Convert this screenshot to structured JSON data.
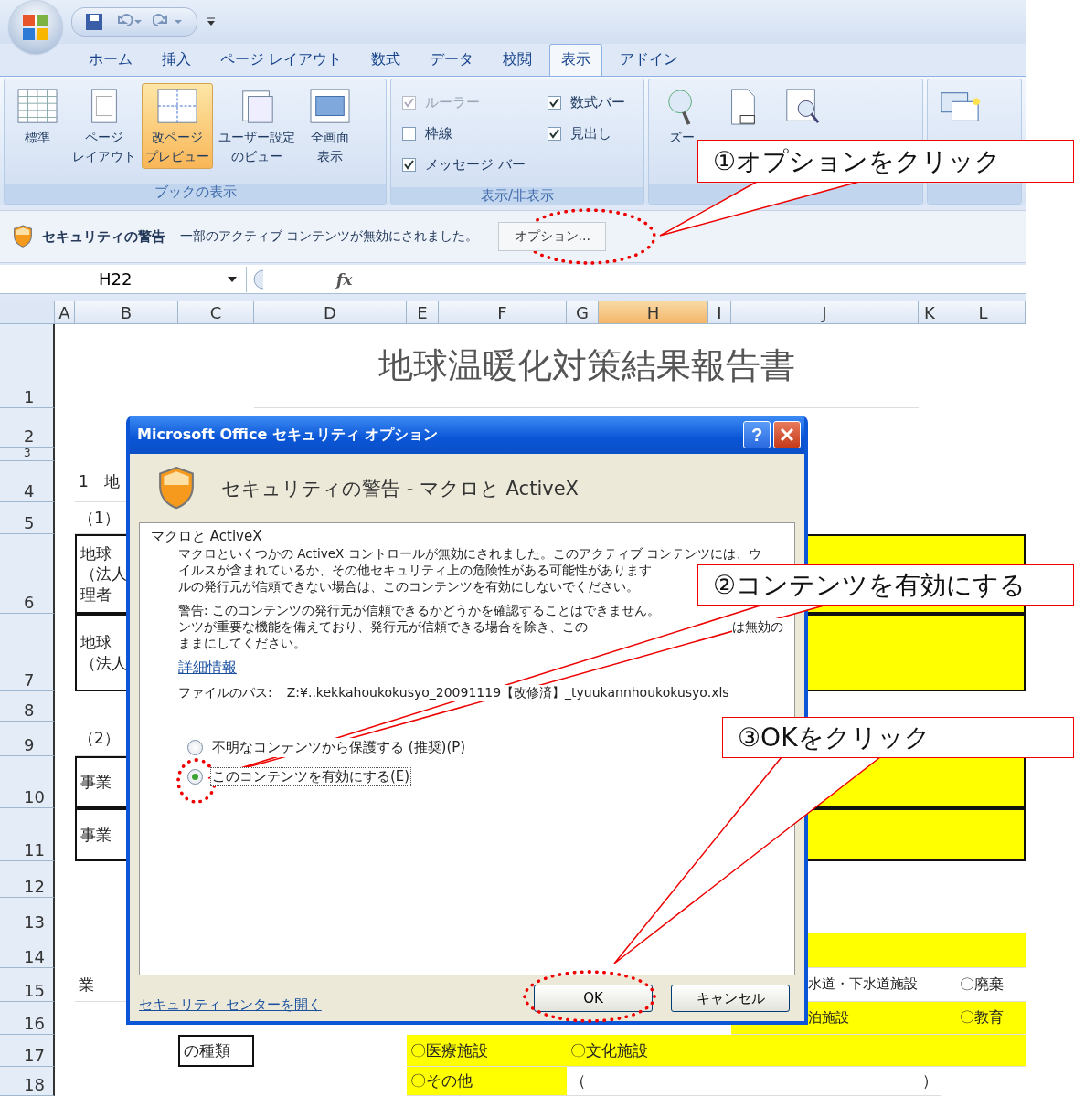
{
  "tabs": [
    {
      "label": "ホーム",
      "selected": false
    },
    {
      "label": "挿入",
      "selected": false
    },
    {
      "label": "ページ レイアウト",
      "selected": false
    },
    {
      "label": "数式",
      "selected": false
    },
    {
      "label": "データ",
      "selected": false
    },
    {
      "label": "校閲",
      "selected": false
    },
    {
      "label": "表示",
      "selected": true
    },
    {
      "label": "アドイン",
      "selected": false
    }
  ],
  "ribbon": {
    "groups": [
      {
        "label": "ブックの表示",
        "buttons": [
          {
            "kind": "normal",
            "lines": [
              "標準"
            ],
            "selected": false
          },
          {
            "kind": "page",
            "lines": [
              "ページ",
              "レイアウト"
            ],
            "selected": false
          },
          {
            "kind": "pagebreak",
            "lines": [
              "改ページ",
              "プレビュー"
            ],
            "selected": true
          },
          {
            "kind": "custom",
            "lines": [
              "ユーザー設定",
              "のビュー"
            ],
            "selected": false
          },
          {
            "kind": "fullscreen",
            "lines": [
              "全画面",
              "表示"
            ],
            "selected": false
          }
        ]
      },
      {
        "label": "表示/非表示",
        "checkboxes": [
          {
            "label": "ルーラー",
            "checked": true,
            "disabled": true
          },
          {
            "label": "枠線",
            "checked": false,
            "disabled": false
          },
          {
            "label": "メッセージ バー",
            "checked": true,
            "disabled": false
          },
          {
            "label": "数式バー",
            "checked": true,
            "disabled": false
          },
          {
            "label": "見出し",
            "checked": true,
            "disabled": false
          }
        ]
      },
      {
        "buttons": [
          {
            "kind": "zoom",
            "lines": [
              "ズー"
            ],
            "selected": false
          },
          {
            "kind": "hundred",
            "selected": false
          },
          {
            "kind": "fit",
            "selected": false
          }
        ]
      },
      {
        "buttons": [
          {
            "kind": "window",
            "selected": false
          }
        ]
      }
    ]
  },
  "security_bar": {
    "title": "セキュリティの警告",
    "message": "一部のアクティブ コンテンツが無効にされました。",
    "button": "オプション..."
  },
  "formula_bar": {
    "name_box": "H22",
    "function_label": "fx"
  },
  "sheet": {
    "columns": [
      {
        "label": "A",
        "selected": false
      },
      {
        "label": "B",
        "selected": false
      },
      {
        "label": "C",
        "selected": false
      },
      {
        "label": "D",
        "selected": false
      },
      {
        "label": "E",
        "selected": false
      },
      {
        "label": "F",
        "selected": false
      },
      {
        "label": "G",
        "selected": false
      },
      {
        "label": "H",
        "selected": true
      },
      {
        "label": "I",
        "selected": false
      },
      {
        "label": "J",
        "selected": false
      },
      {
        "label": "K",
        "selected": false
      },
      {
        "label": "L",
        "selected": false
      }
    ],
    "rows": [
      {
        "label": "1",
        "cells": [
          {
            "lines": [
              "地球温暖化対策結果報告書"
            ],
            "kind": "title",
            "highlighted": false,
            "bordered": false
          }
        ]
      },
      {
        "label": "2"
      },
      {
        "label": "3"
      },
      {
        "label": "4",
        "cells": [
          {
            "lines": [
              "1　地"
            ],
            "kind": "text",
            "highlighted": false,
            "bordered": false
          }
        ]
      },
      {
        "label": "5",
        "cells": [
          {
            "lines": [
              "（1）"
            ],
            "kind": "text",
            "highlighted": false,
            "bordered": false
          }
        ]
      },
      {
        "label": "6",
        "cells": [
          {
            "lines": [
              "地球",
              "（法人",
              "理者"
            ],
            "kind": "text",
            "highlighted": false,
            "bordered": true
          },
          {
            "kind": "plain",
            "highlighted": true,
            "bordered": true
          }
        ]
      },
      {
        "label": "7",
        "cells": [
          {
            "lines": [
              "地球",
              "（法人"
            ],
            "kind": "text",
            "highlighted": false,
            "bordered": true
          },
          {
            "kind": "plain",
            "highlighted": true,
            "bordered": true
          }
        ]
      },
      {
        "label": "8"
      },
      {
        "label": "9",
        "cells": [
          {
            "lines": [
              "（2）"
            ],
            "kind": "text",
            "highlighted": false,
            "bordered": false
          }
        ]
      },
      {
        "label": "10",
        "cells": [
          {
            "lines": [
              "事業"
            ],
            "kind": "text",
            "highlighted": false,
            "bordered": true
          },
          {
            "kind": "plain",
            "highlighted": true,
            "bordered": true
          }
        ]
      },
      {
        "label": "11",
        "cells": [
          {
            "lines": [
              "事業"
            ],
            "kind": "text",
            "highlighted": false,
            "bordered": true
          },
          {
            "kind": "plain",
            "highlighted": true,
            "bordered": true
          }
        ]
      },
      {
        "label": "12"
      },
      {
        "label": "13"
      },
      {
        "label": "14",
        "cells": [
          {
            "kind": "plain",
            "highlighted": true,
            "bordered": false
          }
        ]
      },
      {
        "label": "15",
        "cells": [
          {
            "lines": [
              "業"
            ],
            "kind": "text",
            "highlighted": false,
            "bordered": false
          },
          {
            "lines": [
              "水道・下水道施設"
            ],
            "kind": "under-dialog",
            "highlighted": false,
            "bordered": false
          },
          {
            "lines": [
              "〇廃棄"
            ],
            "kind": "radio",
            "highlighted": false,
            "bordered": false
          }
        ]
      },
      {
        "label": "16",
        "cells": [
          {
            "lines": [
              "泊施設"
            ],
            "kind": "under-dialog",
            "highlighted": true,
            "bordered": false
          },
          {
            "lines": [
              "〇教育"
            ],
            "kind": "radio",
            "highlighted": true,
            "bordered": false
          }
        ]
      },
      {
        "label": "17",
        "cells": [
          {
            "lines": [
              "の種類"
            ],
            "kind": "text",
            "highlighted": false,
            "bordered": true
          },
          {
            "lines": [
              "〇医療施設"
            ],
            "kind": "text",
            "highlighted": true,
            "bordered": false
          },
          {
            "lines": [
              "〇文化施設"
            ],
            "kind": "text",
            "highlighted": true,
            "bordered": false
          }
        ]
      },
      {
        "label": "18",
        "cells": [
          {
            "lines": [
              "〇その他"
            ],
            "kind": "text",
            "highlighted": true,
            "bordered": false
          },
          {
            "lines": [
              "（"
            ],
            "kind": "text",
            "highlighted": false,
            "bordered": false
          },
          {
            "lines": [
              "）"
            ],
            "kind": "text",
            "highlighted": false,
            "bordered": false
          }
        ]
      }
    ]
  },
  "dialog": {
    "title": "Microsoft Office セキュリティ オプション",
    "help_button": "?",
    "heading": "セキュリティの警告 - マクロと ActiveX",
    "section_title": "マクロと ActiveX",
    "paragraphs": [
      {
        "lines": [
          [
            "マクロといくつかの ActiveX コントロールが無効にされました。このアクティブ コンテンツには、ウ"
          ],
          [
            "イルスが含まれているか、その他セキュリティ上の危険性がある可能性があります"
          ],
          [
            "ルの発行元が信頼できない場合は、このコンテンツを有効にしないでください。"
          ]
        ]
      },
      {
        "lines": [
          [
            "警告: このコンテンツの発行元が信頼できるかどうかを確認することはできません。"
          ],
          [
            "ンツが重要な機能を備えており、発行元が信頼できる場合を除き、この",
            "は無効の"
          ],
          [
            "ままにしてください。"
          ]
        ]
      }
    ],
    "link": "詳細情報",
    "file_path_label": "ファイルのパス:",
    "file_path": "Z:¥..kekkahoukokusyo_20091119【改修済】_tyuukannhoukokusyo.xls",
    "options": [
      {
        "label": "不明なコンテンツから保護する (推奨)(P)",
        "selected": false
      },
      {
        "label": "このコンテンツを有効にする(E)",
        "selected": true
      }
    ],
    "footer_link": "セキュリティ センターを開く",
    "buttons": [
      "OK",
      "キャンセル"
    ]
  },
  "callouts": [
    {
      "text": "①オプションをクリック"
    },
    {
      "text": "②コンテンツを有効にする"
    },
    {
      "text": "③OKをクリック"
    }
  ]
}
